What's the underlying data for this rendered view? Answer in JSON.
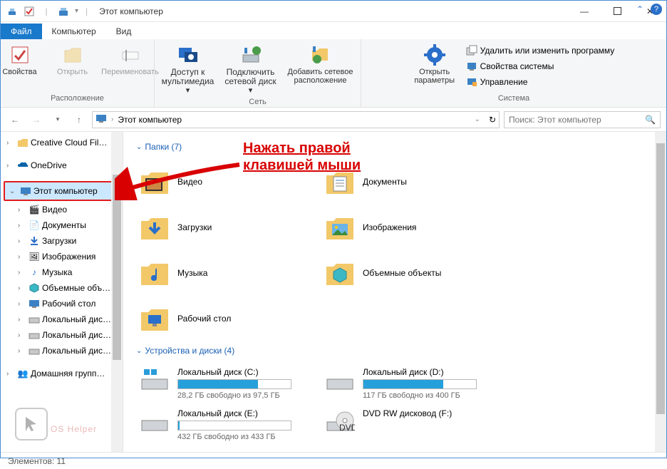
{
  "title": "Этот компьютер",
  "tabs": {
    "file": "Файл",
    "computer": "Компьютер",
    "view": "Вид"
  },
  "ribbon": {
    "group_location": "Расположение",
    "group_network": "Сеть",
    "group_system": "Система",
    "properties": "Свойства",
    "open": "Открыть",
    "rename": "Переименовать",
    "media_access": "Доступ к мультимедиа",
    "map_drive": "Подключить сетевой диск",
    "add_network": "Добавить сетевое расположение",
    "open_settings": "Открыть параметры",
    "uninstall": "Удалить или изменить программу",
    "sys_properties": "Свойства системы",
    "manage": "Управление"
  },
  "nav": {
    "back": "←",
    "fwd": "→",
    "up": "↑",
    "address": "Этот компьютер",
    "search_placeholder": "Поиск: Этот компьютер"
  },
  "tree": {
    "creative_cloud": "Creative Cloud Fil…",
    "onedrive": "OneDrive",
    "this_pc": "Этот компьютер",
    "video": "Видео",
    "documents": "Документы",
    "downloads": "Загрузки",
    "pictures": "Изображения",
    "music": "Музыка",
    "objects3d": "Объемные объ…",
    "desktop": "Рабочий стол",
    "local_disk": "Локальный дис…",
    "local_disk2": "Локальный дис…",
    "local_disk3": "Локальный дис…",
    "homegroup": "Домашняя групп…"
  },
  "folders_header": "Папки (7)",
  "folders": {
    "video": "Видео",
    "documents": "Документы",
    "downloads": "Загрузки",
    "pictures": "Изображения",
    "music": "Музыка",
    "objects3d": "Объемные объекты",
    "desktop": "Рабочий стол"
  },
  "drives_header": "Устройства и диски (4)",
  "drives": [
    {
      "name": "Локальный диск (C:)",
      "free": "28,2 ГБ свободно из 97,5 ГБ",
      "fill": 71
    },
    {
      "name": "Локальный диск (D:)",
      "free": "117 ГБ свободно из 400 ГБ",
      "fill": 71
    },
    {
      "name": "Локальный диск (E:)",
      "free": "432 ГБ свободно из 433 ГБ",
      "fill": 1
    },
    {
      "name": "DVD RW дисковод (F:)",
      "free": "",
      "fill": -1
    }
  ],
  "status": "Элементов: 11",
  "annotation": "Нажать правой клавишей мыши",
  "watermark": "OS Helper"
}
